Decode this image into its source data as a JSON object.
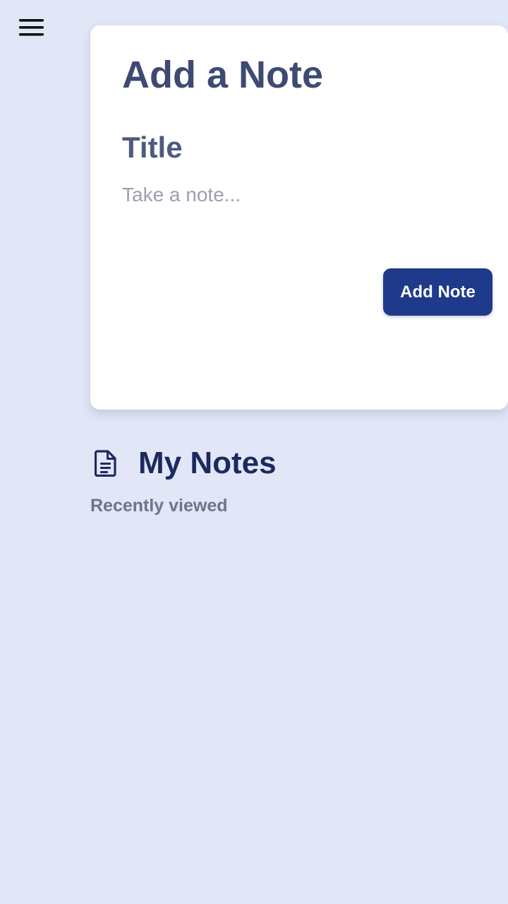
{
  "nav": {
    "menu_icon": "hamburger-menu-icon"
  },
  "add_note_card": {
    "heading": "Add a Note",
    "title_placeholder": "Title",
    "title_value": "",
    "note_placeholder": "Take a note...",
    "note_value": "",
    "submit_label": "Add Note"
  },
  "notes_section": {
    "icon": "document-icon",
    "title": "My Notes",
    "subtitle": "Recently viewed",
    "items": []
  },
  "colors": {
    "background": "#e1e7f7",
    "card": "#ffffff",
    "primary_button": "#1f3a8a",
    "heading": "#3d4a72",
    "section_title": "#1c2a5e",
    "muted_text": "#6f7486"
  }
}
